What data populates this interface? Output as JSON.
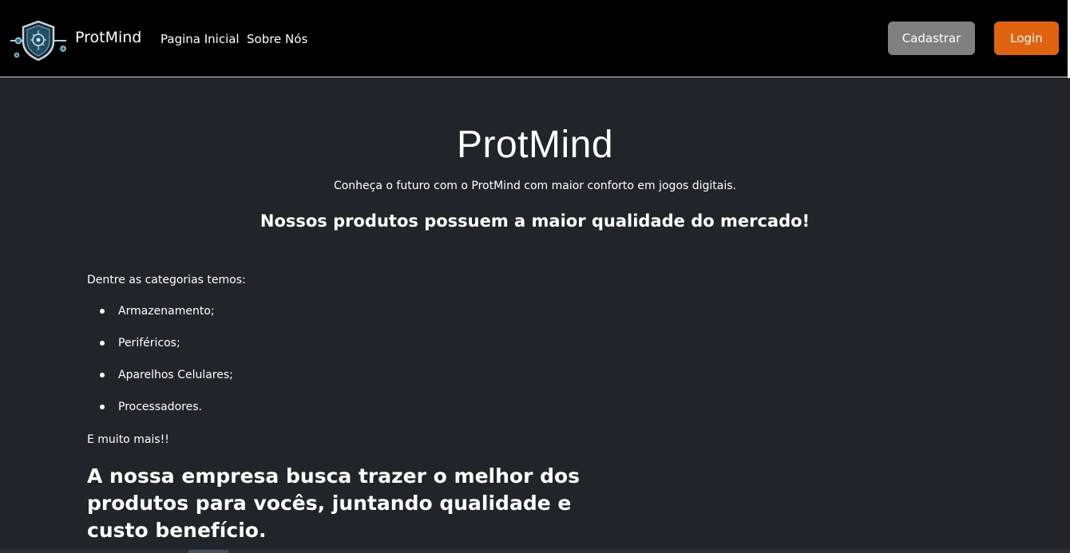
{
  "navbar": {
    "logo_icon": "protmind-logo-icon",
    "brand": "ProtMind",
    "links": [
      "Pagina Inicial",
      "Sobre Nós"
    ],
    "buttons": {
      "cadastrar": "Cadastrar",
      "login": "Login"
    },
    "colors": {
      "cadastrar_bg": "#808080",
      "login_bg": "#e06310",
      "navbar_bg": "#000000"
    }
  },
  "hero": {
    "title": "ProtMind",
    "subtitle": "Conheça o futuro com o ProtMind com maior conforto em jogos digitais.",
    "highlight": "Nossos produtos possuem a maior qualidade do mercado!"
  },
  "content": {
    "intro": "Dentre as categorias temos:",
    "categories": [
      "Armazenamento;",
      "Periféricos;",
      "Aparelhos Celulares;",
      "Processadores."
    ],
    "more": "E muito mais!!",
    "mission": "A nossa empresa busca trazer o melhor dos produtos para vocês, juntando qualidade e custo benefício."
  },
  "colors": {
    "page_bg": "#212529",
    "text": "#ffffff"
  }
}
